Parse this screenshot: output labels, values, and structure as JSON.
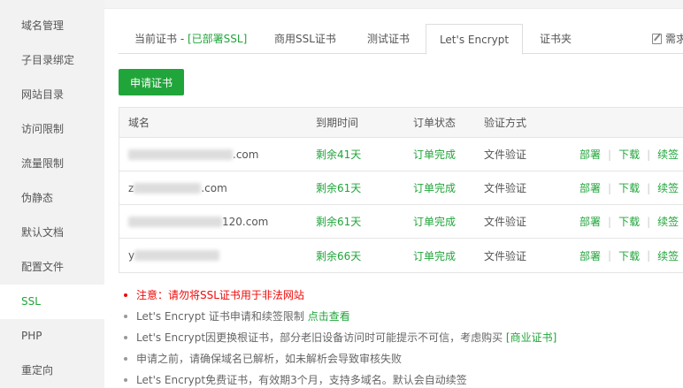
{
  "sidebar": {
    "items": [
      {
        "label": "域名管理"
      },
      {
        "label": "子目录绑定"
      },
      {
        "label": "网站目录"
      },
      {
        "label": "访问限制"
      },
      {
        "label": "流量限制"
      },
      {
        "label": "伪静态"
      },
      {
        "label": "默认文档"
      },
      {
        "label": "配置文件"
      },
      {
        "label": "SSL",
        "active": true
      },
      {
        "label": "PHP"
      },
      {
        "label": "重定向"
      }
    ]
  },
  "tabs": {
    "current_prefix": "当前证书 - ",
    "current_status": "[已部署SSL]",
    "commercial": "商用SSL证书",
    "test": "测试证书",
    "letsencrypt": "Let's Encrypt",
    "folder": "证书夹",
    "edit_label": "需求"
  },
  "apply_button": "申请证书",
  "table": {
    "headers": {
      "domain": "域名",
      "expire": "到期时间",
      "status": "订单状态",
      "verify": "验证方式"
    },
    "rows": [
      {
        "domain_prefix": "",
        "domain_suffix": ".com",
        "expire": "剩余41天",
        "status": "订单完成",
        "verify": "文件验证"
      },
      {
        "domain_prefix": "z",
        "domain_suffix": ".com",
        "expire": "剩余61天",
        "status": "订单完成",
        "verify": "文件验证"
      },
      {
        "domain_prefix": "",
        "domain_suffix": "120.com",
        "expire": "剩余61天",
        "status": "订单完成",
        "verify": "文件验证"
      },
      {
        "domain_prefix": "y",
        "domain_suffix": "",
        "expire": "剩余66天",
        "status": "订单完成",
        "verify": "文件验证"
      }
    ],
    "ops": {
      "deploy": "部署",
      "download": "下载",
      "renew": "续签",
      "separator": "|"
    }
  },
  "notes": {
    "warning": "注意：请勿将SSL证书用于非法网站",
    "limit_text": "Let's Encrypt 证书申请和续签限制 ",
    "limit_link": "点击查看",
    "root_text": "Let's Encrypt因更换根证书，部分老旧设备访问时可能提示不可信，考虑购买 ",
    "root_link": "[商业证书]",
    "resolve": "申请之前，请确保域名已解析，如未解析会导致审核失败",
    "free": "Let's Encrypt免费证书，有效期3个月，支持多域名。默认会自动续签"
  }
}
